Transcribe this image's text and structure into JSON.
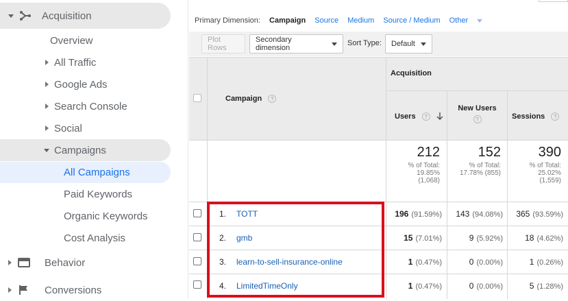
{
  "sidebar": {
    "acquisition": "Acquisition",
    "overview": "Overview",
    "all_traffic": "All Traffic",
    "google_ads": "Google Ads",
    "search_console": "Search Console",
    "social": "Social",
    "campaigns": "Campaigns",
    "all_campaigns": "All Campaigns",
    "paid_keywords": "Paid Keywords",
    "organic_keywords": "Organic Keywords",
    "cost_analysis": "Cost Analysis",
    "behavior": "Behavior",
    "conversions": "Conversions"
  },
  "dimension_bar": {
    "label": "Primary Dimension:",
    "current": "Campaign",
    "options": [
      "Source",
      "Medium",
      "Source / Medium",
      "Other"
    ]
  },
  "toolbar": {
    "plot_rows": "Plot Rows",
    "secondary_dimension": "Secondary dimension",
    "sort_type_label": "Sort Type:",
    "sort_type_value": "Default"
  },
  "table": {
    "campaign_header": "Campaign",
    "group_header": "Acquisition",
    "users_header": "Users",
    "new_users_header": "New Users",
    "sessions_header": "Sessions",
    "totals": {
      "users": "212",
      "users_sub1": "% of Total:",
      "users_sub2": "19.85%",
      "users_sub3": "(1,068)",
      "new_users": "152",
      "new_users_sub1": "% of Total:",
      "new_users_sub2": "17.78% (855)",
      "sessions": "390",
      "sessions_sub1": "% of Total:",
      "sessions_sub2": "25.02%",
      "sessions_sub3": "(1,559)"
    },
    "rows": [
      {
        "num": "1.",
        "campaign": "TOTT",
        "users": "196",
        "users_pct": "(91.59%)",
        "new_users": "143",
        "new_users_pct": "(94.08%)",
        "sessions": "365",
        "sessions_pct": "(93.59%)"
      },
      {
        "num": "2.",
        "campaign": "gmb",
        "users": "15",
        "users_pct": "(7.01%)",
        "new_users": "9",
        "new_users_pct": "(5.92%)",
        "sessions": "18",
        "sessions_pct": "(4.62%)"
      },
      {
        "num": "3.",
        "campaign": "learn-to-sell-insurance-online",
        "users": "1",
        "users_pct": "(0.47%)",
        "new_users": "0",
        "new_users_pct": "(0.00%)",
        "sessions": "1",
        "sessions_pct": "(0.26%)"
      },
      {
        "num": "4.",
        "campaign": "LimitedTimeOnly",
        "users": "1",
        "users_pct": "(0.47%)",
        "new_users": "0",
        "new_users_pct": "(0.00%)",
        "sessions": "5",
        "sessions_pct": "(1.28%)"
      }
    ]
  },
  "colors": {
    "highlight_border": "#d8101f",
    "link": "#1a5fb4",
    "active_nav": "#1a73e8"
  }
}
